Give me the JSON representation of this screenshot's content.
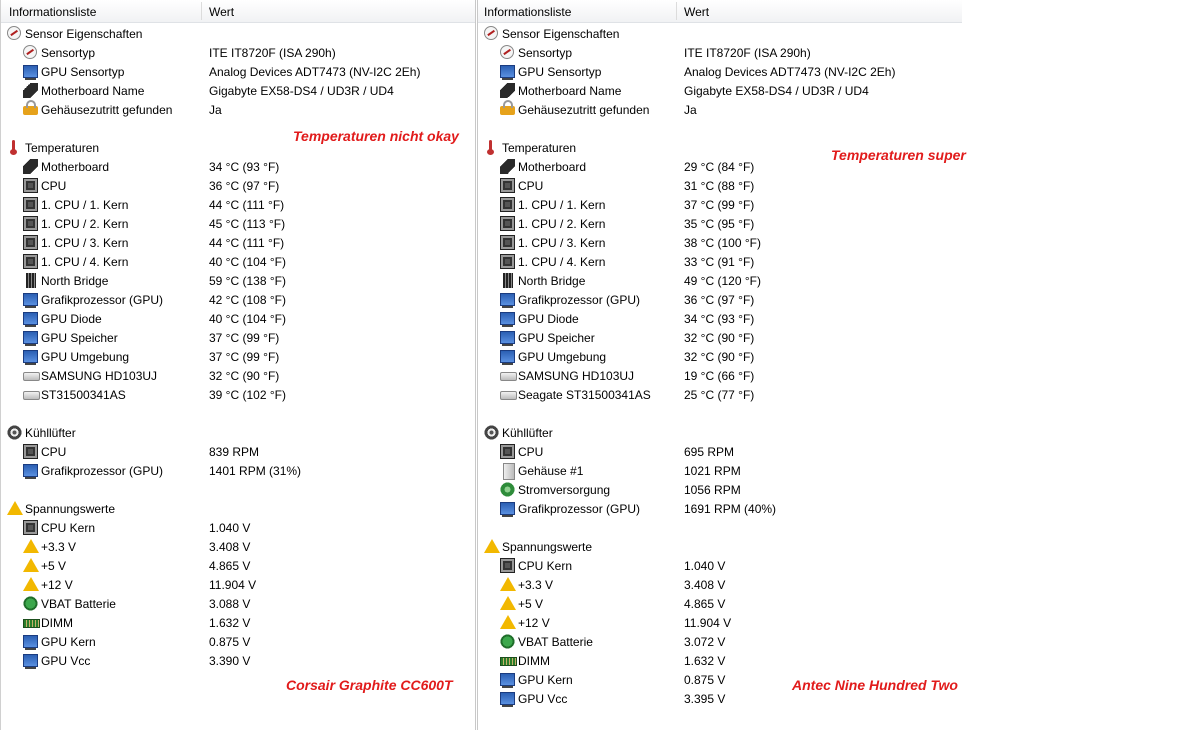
{
  "header": {
    "col1": "Informationsliste",
    "col2": "Wert"
  },
  "left": {
    "annotations": [
      {
        "id": "temp",
        "text": "Temperaturen nicht okay"
      },
      {
        "id": "case",
        "text": "Corsair Graphite CC600T"
      }
    ],
    "rows": [
      {
        "type": "section",
        "icon": "sensor-icon",
        "label": "Sensor Eigenschaften",
        "value": ""
      },
      {
        "type": "item",
        "icon": "sensor-icon",
        "label": "Sensortyp",
        "value": "ITE IT8720F  (ISA 290h)"
      },
      {
        "type": "item",
        "icon": "gpu-icon",
        "label": "GPU Sensortyp",
        "value": "Analog Devices ADT7473  (NV-I2C 2Eh)"
      },
      {
        "type": "item",
        "icon": "motherboard-icon",
        "label": "Motherboard Name",
        "value": "Gigabyte EX58-DS4 / UD3R / UD4"
      },
      {
        "type": "item",
        "icon": "lock-icon",
        "label": "Gehäusezutritt gefunden",
        "value": "Ja"
      },
      {
        "type": "blank"
      },
      {
        "type": "section",
        "icon": "thermometer-icon",
        "label": "Temperaturen",
        "value": ""
      },
      {
        "type": "item",
        "icon": "motherboard-icon",
        "label": "Motherboard",
        "value": "34 °C  (93 °F)"
      },
      {
        "type": "item",
        "icon": "cpu-icon",
        "label": "CPU",
        "value": "36 °C  (97 °F)"
      },
      {
        "type": "item",
        "icon": "cpu-icon",
        "label": "1. CPU / 1. Kern",
        "value": "44 °C  (111 °F)"
      },
      {
        "type": "item",
        "icon": "cpu-icon",
        "label": "1. CPU / 2. Kern",
        "value": "45 °C  (113 °F)"
      },
      {
        "type": "item",
        "icon": "cpu-icon",
        "label": "1. CPU / 3. Kern",
        "value": "44 °C  (111 °F)"
      },
      {
        "type": "item",
        "icon": "cpu-icon",
        "label": "1. CPU / 4. Kern",
        "value": "40 °C  (104 °F)"
      },
      {
        "type": "item",
        "icon": "northbridge-icon",
        "label": "North Bridge",
        "value": "59 °C  (138 °F)"
      },
      {
        "type": "item",
        "icon": "gpu-icon",
        "label": "Grafikprozessor (GPU)",
        "value": "42 °C  (108 °F)"
      },
      {
        "type": "item",
        "icon": "gpu-icon",
        "label": "GPU Diode",
        "value": "40 °C  (104 °F)"
      },
      {
        "type": "item",
        "icon": "gpu-icon",
        "label": "GPU Speicher",
        "value": "37 °C  (99 °F)"
      },
      {
        "type": "item",
        "icon": "gpu-icon",
        "label": "GPU Umgebung",
        "value": "37 °C  (99 °F)"
      },
      {
        "type": "item",
        "icon": "hdd-icon",
        "label": "SAMSUNG HD103UJ",
        "value": "32 °C  (90 °F)"
      },
      {
        "type": "item",
        "icon": "hdd-icon",
        "label": "ST31500341AS",
        "value": "39 °C  (102 °F)"
      },
      {
        "type": "blank"
      },
      {
        "type": "section",
        "icon": "fan-icon",
        "label": "Kühllüfter",
        "value": ""
      },
      {
        "type": "item",
        "icon": "cpu-icon",
        "label": "CPU",
        "value": "839 RPM"
      },
      {
        "type": "item",
        "icon": "gpu-icon",
        "label": "Grafikprozessor (GPU)",
        "value": "1401 RPM  (31%)"
      },
      {
        "type": "blank"
      },
      {
        "type": "section",
        "icon": "warning-icon",
        "label": "Spannungswerte",
        "value": ""
      },
      {
        "type": "item",
        "icon": "cpu-icon",
        "label": "CPU Kern",
        "value": "1.040 V"
      },
      {
        "type": "item",
        "icon": "warning-icon",
        "label": "+3.3 V",
        "value": "3.408 V"
      },
      {
        "type": "item",
        "icon": "warning-icon",
        "label": "+5 V",
        "value": "4.865 V"
      },
      {
        "type": "item",
        "icon": "warning-icon",
        "label": "+12 V",
        "value": "11.904 V"
      },
      {
        "type": "item",
        "icon": "battery-icon",
        "label": "VBAT Batterie",
        "value": "3.088 V"
      },
      {
        "type": "item",
        "icon": "dimm-icon",
        "label": "DIMM",
        "value": "1.632 V"
      },
      {
        "type": "item",
        "icon": "gpu-icon",
        "label": "GPU Kern",
        "value": "0.875 V"
      },
      {
        "type": "item",
        "icon": "gpu-icon",
        "label": "GPU Vcc",
        "value": "3.390 V"
      }
    ]
  },
  "right": {
    "annotations": [
      {
        "id": "temp",
        "text": "Temperaturen super"
      },
      {
        "id": "case",
        "text": "Antec Nine Hundred Two"
      }
    ],
    "rows": [
      {
        "type": "section",
        "icon": "sensor-icon",
        "label": "Sensor Eigenschaften",
        "value": ""
      },
      {
        "type": "item",
        "icon": "sensor-icon",
        "label": "Sensortyp",
        "value": "ITE IT8720F  (ISA 290h)"
      },
      {
        "type": "item",
        "icon": "gpu-icon",
        "label": "GPU Sensortyp",
        "value": "Analog Devices ADT7473  (NV-I2C 2Eh)"
      },
      {
        "type": "item",
        "icon": "motherboard-icon",
        "label": "Motherboard Name",
        "value": "Gigabyte EX58-DS4 / UD3R / UD4"
      },
      {
        "type": "item",
        "icon": "lock-icon",
        "label": "Gehäusezutritt gefunden",
        "value": "Ja"
      },
      {
        "type": "blank"
      },
      {
        "type": "section",
        "icon": "thermometer-icon",
        "label": "Temperaturen",
        "value": ""
      },
      {
        "type": "item",
        "icon": "motherboard-icon",
        "label": "Motherboard",
        "value": "29 °C  (84 °F)"
      },
      {
        "type": "item",
        "icon": "cpu-icon",
        "label": "CPU",
        "value": "31 °C  (88 °F)"
      },
      {
        "type": "item",
        "icon": "cpu-icon",
        "label": "1. CPU / 1. Kern",
        "value": "37 °C  (99 °F)"
      },
      {
        "type": "item",
        "icon": "cpu-icon",
        "label": "1. CPU / 2. Kern",
        "value": "35 °C  (95 °F)"
      },
      {
        "type": "item",
        "icon": "cpu-icon",
        "label": "1. CPU / 3. Kern",
        "value": "38 °C  (100 °F)"
      },
      {
        "type": "item",
        "icon": "cpu-icon",
        "label": "1. CPU / 4. Kern",
        "value": "33 °C  (91 °F)"
      },
      {
        "type": "item",
        "icon": "northbridge-icon",
        "label": "North Bridge",
        "value": "49 °C  (120 °F)"
      },
      {
        "type": "item",
        "icon": "gpu-icon",
        "label": "Grafikprozessor (GPU)",
        "value": "36 °C  (97 °F)"
      },
      {
        "type": "item",
        "icon": "gpu-icon",
        "label": "GPU Diode",
        "value": "34 °C  (93 °F)"
      },
      {
        "type": "item",
        "icon": "gpu-icon",
        "label": "GPU Speicher",
        "value": "32 °C  (90 °F)"
      },
      {
        "type": "item",
        "icon": "gpu-icon",
        "label": "GPU Umgebung",
        "value": "32 °C  (90 °F)"
      },
      {
        "type": "item",
        "icon": "hdd-icon",
        "label": "SAMSUNG HD103UJ",
        "value": "19 °C  (66 °F)"
      },
      {
        "type": "item",
        "icon": "hdd-icon",
        "label": "Seagate ST31500341AS",
        "value": "25 °C  (77 °F)"
      },
      {
        "type": "blank"
      },
      {
        "type": "section",
        "icon": "fan-icon",
        "label": "Kühllüfter",
        "value": ""
      },
      {
        "type": "item",
        "icon": "cpu-icon",
        "label": "CPU",
        "value": "695 RPM"
      },
      {
        "type": "item",
        "icon": "case-icon",
        "label": "Gehäuse #1",
        "value": "1021 RPM"
      },
      {
        "type": "item",
        "icon": "power-supply-icon",
        "label": "Stromversorgung",
        "value": "1056 RPM"
      },
      {
        "type": "item",
        "icon": "gpu-icon",
        "label": "Grafikprozessor (GPU)",
        "value": "1691 RPM  (40%)"
      },
      {
        "type": "blank"
      },
      {
        "type": "section",
        "icon": "warning-icon",
        "label": "Spannungswerte",
        "value": ""
      },
      {
        "type": "item",
        "icon": "cpu-icon",
        "label": "CPU Kern",
        "value": "1.040 V"
      },
      {
        "type": "item",
        "icon": "warning-icon",
        "label": "+3.3 V",
        "value": "3.408 V"
      },
      {
        "type": "item",
        "icon": "warning-icon",
        "label": "+5 V",
        "value": "4.865 V"
      },
      {
        "type": "item",
        "icon": "warning-icon",
        "label": "+12 V",
        "value": "11.904 V"
      },
      {
        "type": "item",
        "icon": "battery-icon",
        "label": "VBAT Batterie",
        "value": "3.072 V"
      },
      {
        "type": "item",
        "icon": "dimm-icon",
        "label": "DIMM",
        "value": "1.632 V"
      },
      {
        "type": "item",
        "icon": "gpu-icon",
        "label": "GPU Kern",
        "value": "0.875 V"
      },
      {
        "type": "item",
        "icon": "gpu-icon",
        "label": "GPU Vcc",
        "value": "3.395 V"
      }
    ]
  }
}
